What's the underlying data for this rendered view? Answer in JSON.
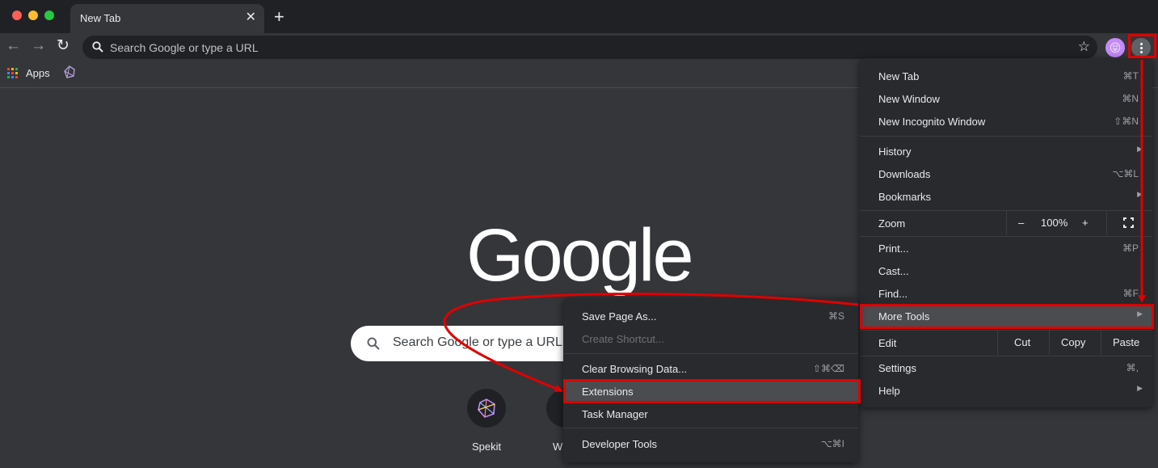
{
  "tab": {
    "title": "New Tab",
    "close_glyph": "✕"
  },
  "toolbar": {
    "omnibox_placeholder": "Search Google or type a URL"
  },
  "bookmarks": {
    "apps_label": "Apps"
  },
  "page": {
    "logo": "Google",
    "search_placeholder": "Search Google or type a URL",
    "shortcuts": [
      {
        "label": "Spekit"
      },
      {
        "label": "W"
      }
    ]
  },
  "main_menu": {
    "new_tab": {
      "label": "New Tab",
      "shortcut": "⌘T"
    },
    "new_window": {
      "label": "New Window",
      "shortcut": "⌘N"
    },
    "new_incognito": {
      "label": "New Incognito Window",
      "shortcut": "⇧⌘N"
    },
    "history": {
      "label": "History"
    },
    "downloads": {
      "label": "Downloads",
      "shortcut": "⌥⌘L"
    },
    "bookmarks": {
      "label": "Bookmarks"
    },
    "zoom": {
      "label": "Zoom",
      "minus": "–",
      "value": "100%",
      "plus": "+"
    },
    "print": {
      "label": "Print...",
      "shortcut": "⌘P"
    },
    "cast": {
      "label": "Cast..."
    },
    "find": {
      "label": "Find...",
      "shortcut": "⌘F"
    },
    "more_tools": {
      "label": "More Tools"
    },
    "edit": {
      "label": "Edit",
      "cut": "Cut",
      "copy": "Copy",
      "paste": "Paste"
    },
    "settings": {
      "label": "Settings",
      "shortcut": "⌘,"
    },
    "help": {
      "label": "Help"
    }
  },
  "sub_menu": {
    "save_page": {
      "label": "Save Page As...",
      "shortcut": "⌘S"
    },
    "create_shortcut": {
      "label": "Create Shortcut..."
    },
    "clear_data": {
      "label": "Clear Browsing Data...",
      "shortcut": "⇧⌘⌫"
    },
    "extensions": {
      "label": "Extensions"
    },
    "task_manager": {
      "label": "Task Manager"
    },
    "dev_tools": {
      "label": "Developer Tools",
      "shortcut": "⌥⌘I"
    }
  },
  "colors": {
    "annotation": "#e00000",
    "background": "#35363a",
    "menu": "#292a2d",
    "highlight": "#4a4c50"
  }
}
